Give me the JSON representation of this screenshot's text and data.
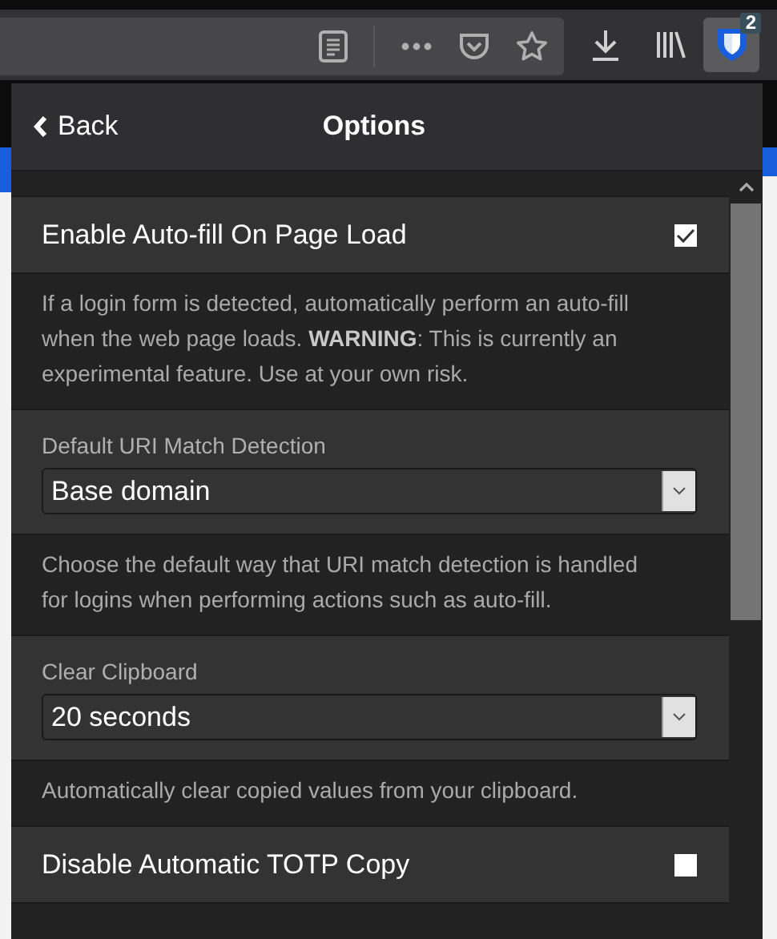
{
  "extension_badge": "2",
  "header": {
    "back": "Back",
    "title": "Options"
  },
  "sections": [
    {
      "kind": "checkbox",
      "label": "Enable Auto-fill On Page Load",
      "checked": true,
      "help": "If a login form is detected, automatically perform an auto-fill when the web page loads. **WARNING**: This is currently an experimental feature. Use at your own risk."
    },
    {
      "kind": "select",
      "label": "Default URI Match Detection",
      "value": "Base domain",
      "help": "Choose the default way that URI match detection is handled for logins when performing actions such as auto-fill."
    },
    {
      "kind": "select",
      "label": "Clear Clipboard",
      "value": "20 seconds",
      "help": "Automatically clear copied values from your clipboard."
    },
    {
      "kind": "checkbox",
      "label": "Disable Automatic TOTP Copy",
      "checked": false
    }
  ]
}
